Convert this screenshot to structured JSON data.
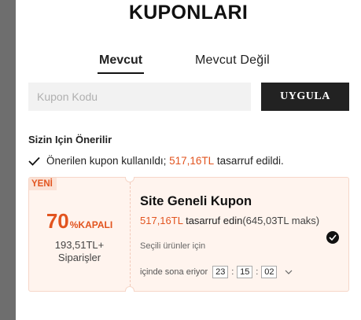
{
  "page": {
    "title": "KUPONLARI"
  },
  "tabs": [
    {
      "label": "Mevcut",
      "active": true
    },
    {
      "label": "Mevcut Değil",
      "active": false
    }
  ],
  "coupon_entry": {
    "placeholder": "Kupon Kodu",
    "value": "",
    "apply_label": "UYGULA"
  },
  "recommendations": {
    "title": "Sizin Için Önerilir",
    "applied_notice": {
      "prefix": "Önerilen kupon kullanıldı;",
      "amount": "517,16TL",
      "suffix": "tasarruf edildi."
    }
  },
  "coupon": {
    "badge": "YENİ",
    "discount_value": "70",
    "discount_suffix": "%KAPALI",
    "min_order_line1": "193,51TL+",
    "min_order_line2": "Siparişler",
    "name": "Site Geneli Kupon",
    "savings_amount": "517,16TL",
    "savings_text": "tasarruf edin",
    "savings_max": "(645,03TL maks)",
    "scope": "Seçili ürünler için",
    "expiry_label": "içinde sona eriyor",
    "countdown": {
      "hours": "23",
      "minutes": "15",
      "seconds": "02"
    },
    "selected": true
  },
  "colors": {
    "accent": "#e2541f",
    "card_bg": "#fff4ee",
    "button_bg": "#222222"
  },
  "icons": {
    "check": "check-icon",
    "chevron": "chevron-down-icon",
    "selected": "selected-check-icon"
  }
}
